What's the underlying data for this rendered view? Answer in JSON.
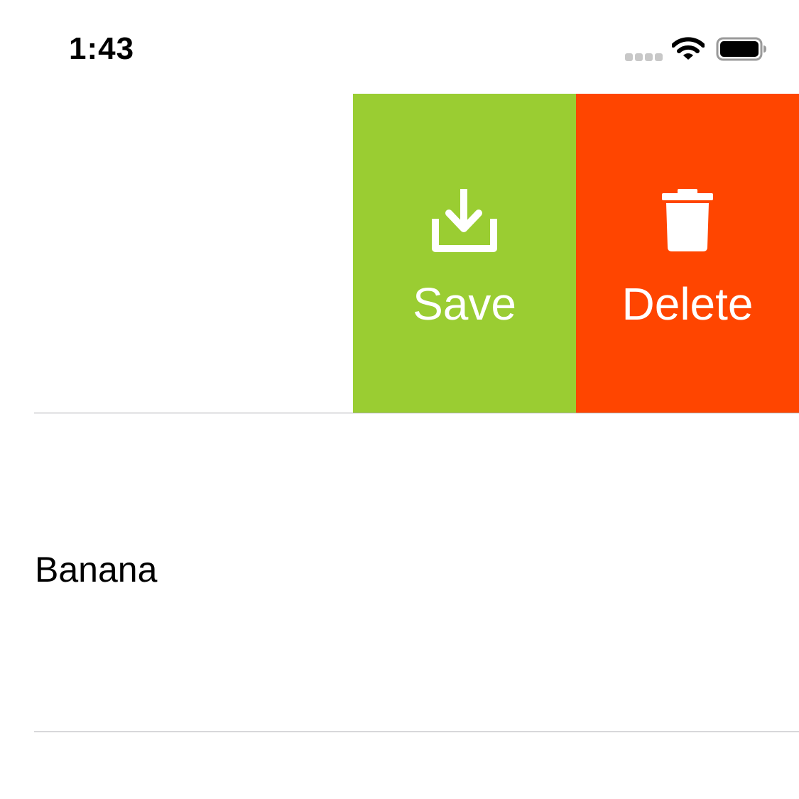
{
  "status_bar": {
    "time": "1:43",
    "signal_icon": "cellular-signal-icon",
    "wifi_icon": "wifi-icon",
    "battery_icon": "battery-icon"
  },
  "swipe_actions": [
    {
      "label": "Save",
      "icon": "download-tray-icon",
      "color": "#9ACD32"
    },
    {
      "label": "Delete",
      "icon": "trash-icon",
      "color": "#FF4500"
    }
  ],
  "list": {
    "items": [
      {
        "label": ""
      },
      {
        "label": "Banana"
      }
    ]
  },
  "colors": {
    "separator": "#A9A9AE",
    "background": "#FFFFFF"
  }
}
